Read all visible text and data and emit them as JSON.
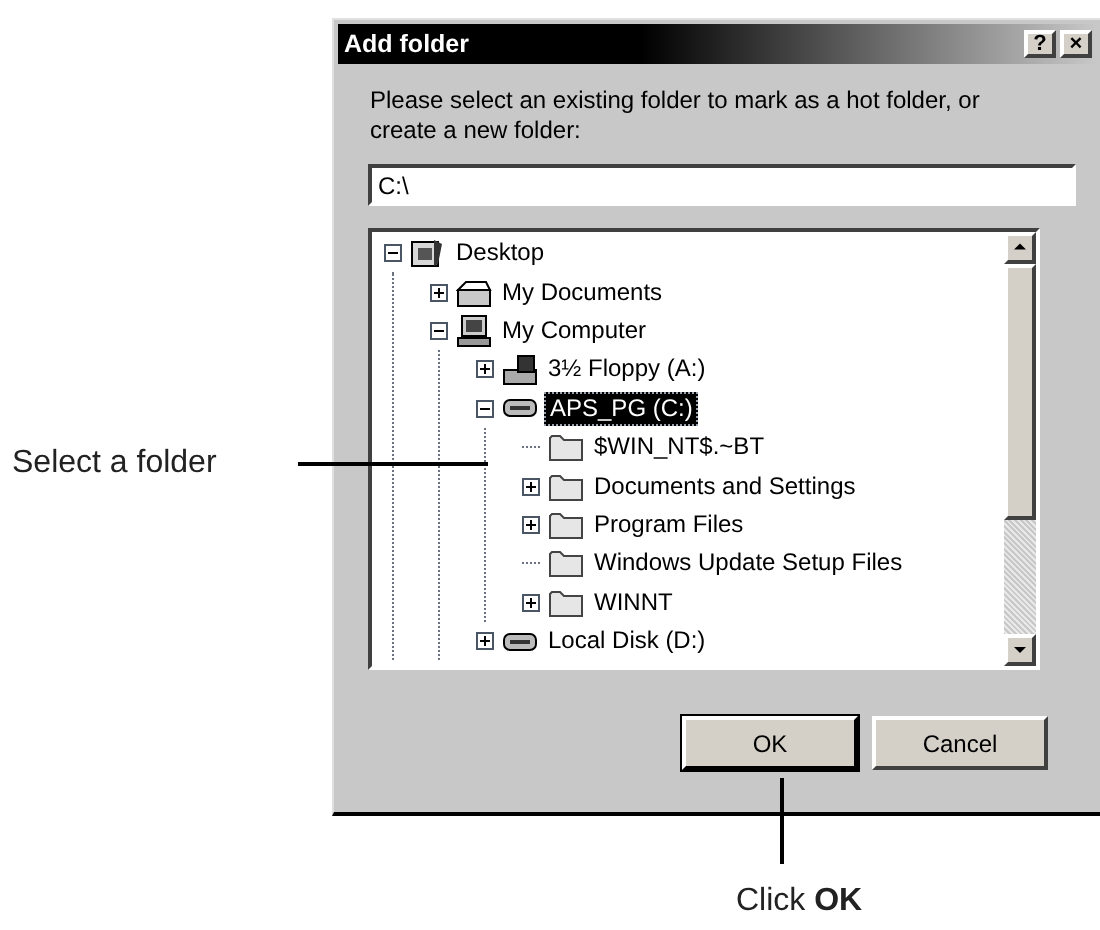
{
  "callouts": [
    {
      "kind": "left",
      "text": "Select a folder"
    },
    {
      "kind": "below",
      "text": "Click **OK**"
    }
  ],
  "dialog": {
    "title": "Add folder",
    "title_buttons": [
      "?",
      "×"
    ],
    "prompt": "Please select an existing folder to mark as a hot folder, or create a new folder:",
    "path_field": {
      "value": "C:\\"
    },
    "tree": [
      {
        "label": "Desktop",
        "kind": "desktop",
        "expanded": true,
        "selected": false,
        "children": [
          {
            "label": "My Documents",
            "kind": "documents",
            "expanded": false,
            "selected": false
          },
          {
            "label": "My Computer",
            "kind": "computer",
            "expanded": true,
            "selected": false,
            "children": [
              {
                "label": "3½ Floppy (A:)",
                "kind": "floppy",
                "expanded": false,
                "selected": false
              },
              {
                "label": "APS_PG (C:)",
                "kind": "drive",
                "expanded": true,
                "selected": true,
                "children": [
                  {
                    "label": "$WIN_NT$.~BT",
                    "kind": "folder",
                    "selected": false
                  },
                  {
                    "label": "Documents and Settings",
                    "kind": "folder",
                    "expanded": false,
                    "selected": false
                  },
                  {
                    "label": "Program Files",
                    "kind": "folder",
                    "expanded": false,
                    "selected": false
                  },
                  {
                    "label": "Windows Update Setup Files",
                    "kind": "folder",
                    "selected": false
                  },
                  {
                    "label": "WINNT",
                    "kind": "folder",
                    "expanded": false,
                    "selected": false
                  }
                ]
              },
              {
                "label": "Local Disk (D:)",
                "kind": "drive",
                "expanded": false,
                "selected": false
              }
            ]
          }
        ]
      }
    ],
    "buttons": [
      "OK",
      "Cancel"
    ]
  }
}
